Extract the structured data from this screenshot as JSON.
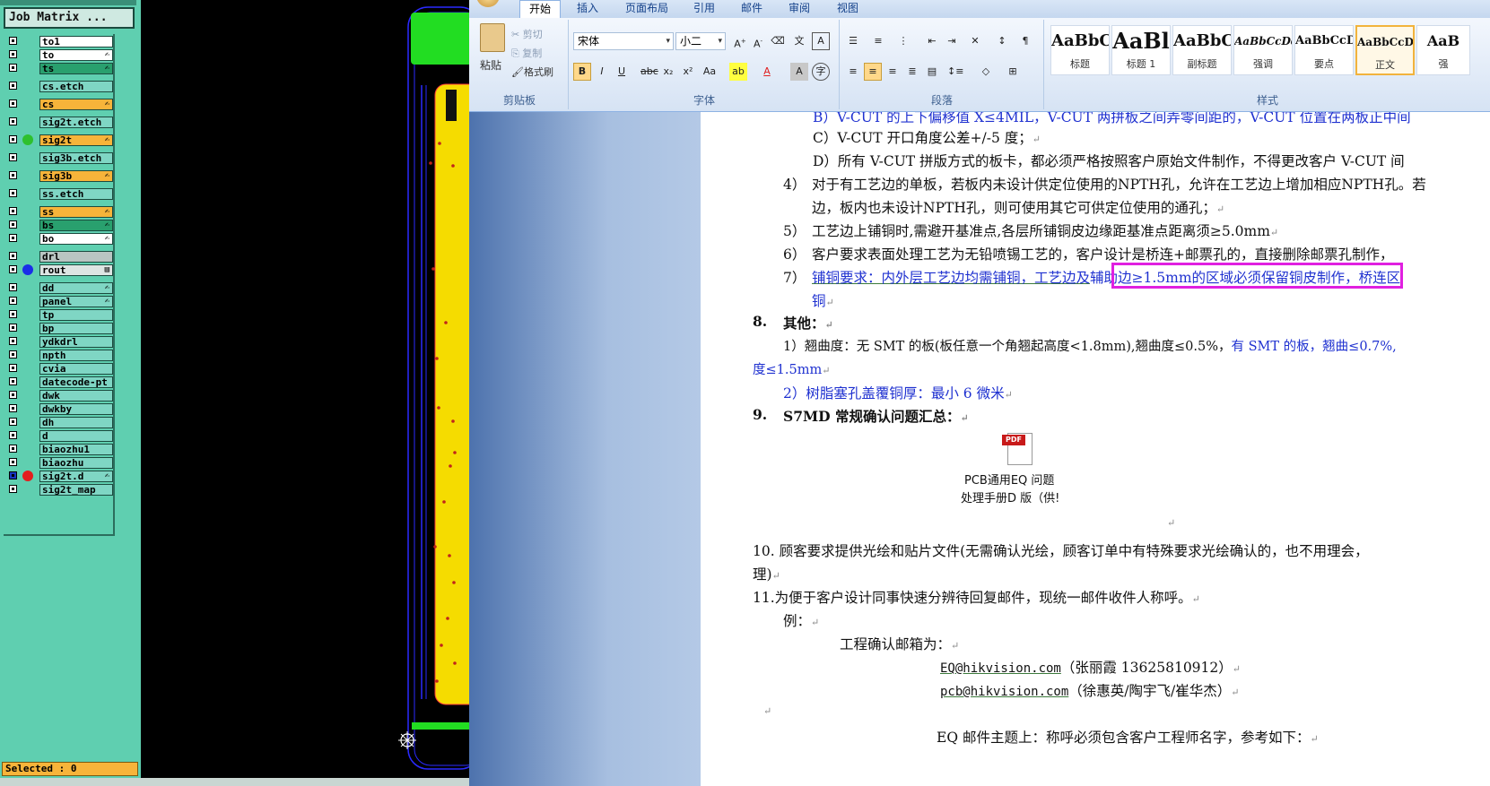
{
  "cam": {
    "job_matrix_title": "Job Matrix ...",
    "layers": [
      {
        "name": "to1",
        "color": "white"
      },
      {
        "name": "to",
        "color": "white",
        "marker": "✍"
      },
      {
        "name": "ts",
        "color": "green",
        "marker": "✍"
      },
      {
        "name": "cs.etch",
        "color": "teal"
      },
      {
        "name": "cs",
        "color": "orange",
        "marker": "✍"
      },
      {
        "name": "sig2t.etch",
        "color": "teal"
      },
      {
        "name": "sig2t",
        "color": "orange",
        "marker": "✍",
        "dot": "#2ec02e"
      },
      {
        "name": "sig3b.etch",
        "color": "teal"
      },
      {
        "name": "sig3b",
        "color": "orange",
        "marker": "✍"
      },
      {
        "name": "ss.etch",
        "color": "teal"
      },
      {
        "name": "ss",
        "color": "orange",
        "marker": "✍"
      },
      {
        "name": "bs",
        "color": "green",
        "marker": "✍"
      },
      {
        "name": "bo",
        "color": "white",
        "marker": "✍"
      },
      {
        "name": "drl",
        "color": "gray"
      },
      {
        "name": "rout",
        "color": "light",
        "marker": "▤",
        "dot": "#1a2ee8"
      },
      {
        "name": "dd",
        "color": "teal",
        "marker": "✍"
      },
      {
        "name": "panel",
        "color": "teal",
        "marker": "✍"
      },
      {
        "name": "tp",
        "color": "teal"
      },
      {
        "name": "bp",
        "color": "teal"
      },
      {
        "name": "ydkdrl",
        "color": "teal"
      },
      {
        "name": "npth",
        "color": "teal"
      },
      {
        "name": "cvia",
        "color": "teal"
      },
      {
        "name": "datecode-pt",
        "color": "teal"
      },
      {
        "name": "dwk",
        "color": "teal"
      },
      {
        "name": "dwkby",
        "color": "teal"
      },
      {
        "name": "dh",
        "color": "teal"
      },
      {
        "name": "d",
        "color": "teal"
      },
      {
        "name": "biaozhu1",
        "color": "teal"
      },
      {
        "name": "biaozhu",
        "color": "teal"
      },
      {
        "name": "sig2t.d",
        "color": "teal",
        "marker": "✍",
        "dot": "#e31e1e",
        "selected": true
      },
      {
        "name": "sig2t_map",
        "color": "teal"
      }
    ],
    "selected_text": "Selected : 0",
    "colors": {
      "panel": "#5fcfb0",
      "orange": "#f7b43a",
      "board": "#f5dc00",
      "outline": "#2323ff",
      "pad": "#22dd22"
    }
  },
  "word": {
    "tabs": [
      "开始",
      "插入",
      "页面布局",
      "引用",
      "邮件",
      "审阅",
      "视图"
    ],
    "active_tab": "开始",
    "clipboard": {
      "paste": "粘贴",
      "cut": "剪切",
      "copy": "复制",
      "format_painter": "格式刷",
      "label": "剪贴板"
    },
    "font": {
      "name": "宋体",
      "size": "小二",
      "label": "字体"
    },
    "paragraph_label": "段落",
    "styles_label": "样式",
    "styles": [
      {
        "preview": "AaBbC",
        "name": "标题"
      },
      {
        "preview": "AaBl",
        "name": "标题 1"
      },
      {
        "preview": "AaBbC",
        "name": "副标题"
      },
      {
        "preview": "AaBbCcDd",
        "name": "强调"
      },
      {
        "preview": "AaBbCcD",
        "name": "要点"
      },
      {
        "preview": "AaBbCcDd",
        "name": "正文",
        "active": true
      },
      {
        "preview": "AaB",
        "name": "强"
      }
    ],
    "doc": {
      "l0": "B）V-CUT 的上下偏移值 X≤4MIL，V-CUT 两拼板之间弄零间距的，V-CUT 位置在两板正中间",
      "l1": "C）V-CUT 开口角度公差+/-5 度；",
      "l2": "D）所有 V-CUT 拼版方式的板卡，都必须严格按照客户原始文件制作，不得更改客户 V-CUT 间",
      "l3_num": "4）",
      "l3": "对于有工艺边的单板，若板内未设计供定位使用的NPTH孔，允许在工艺边上增加相应NPTH孔。若",
      "l4": "边，板内也未设计NPTH孔，则可使用其它可供定位使用的通孔；",
      "l5_num": "5）",
      "l5": "工艺边上铺铜时,需避开基准点,各层所铺铜皮边缘距基准点距离须≥5.0mm",
      "l6_num": "6）",
      "l6": "客户要求表面处理工艺为无铅喷锡工艺的，客户设计是桥连+邮票孔的，直接删除邮票孔制作，",
      "l7_num": "7）",
      "l7a": "铺铜要求：内外层工艺边均需铺铜，工艺边及",
      "l7b": "辅助边≥1.5mm的区域必须保留铜皮制作",
      "l7c": "，桥连区",
      "l7d": "铜",
      "h8_num": "8.",
      "h8": "其他：",
      "l9": "1）翘曲度：无 SMT 的板(板任意一个角翘起高度<1.8mm),翘曲度≤0.5%，",
      "l9b": "有 SMT 的板，翘曲≤0.7%,",
      "l10": "度≤1.5mm",
      "l11": "2）树脂塞孔盖覆铜厚：最小 6 微米",
      "h9_num": "9.",
      "h9": "S7MD 常规确认问题汇总：",
      "pdf_badge": "PDF",
      "pdf_line1": "PCB通用EQ 问题",
      "pdf_line2": "处理手册D 版（供!",
      "l12": "10.  顾客要求提供光绘和贴片文件(无需确认光绘，顾客订单中有特殊要求光绘确认的，也不用理会，",
      "l13": "理)",
      "l14": "11.为便于客户设计同事快速分辨待回复邮件，现统一邮件收件人称呼。",
      "l15": "例：",
      "l16": "工程确认邮箱为：",
      "email1": "EQ@hikvision.com",
      "email1_names": "（张丽霞  13625810912）",
      "email2": "pcb@hikvision.com",
      "email2_names": "（徐惠英/陶宇飞/崔华杰）",
      "l17": "EQ 邮件主题上：称呼必须包含客户工程师名字，参考如下："
    }
  }
}
